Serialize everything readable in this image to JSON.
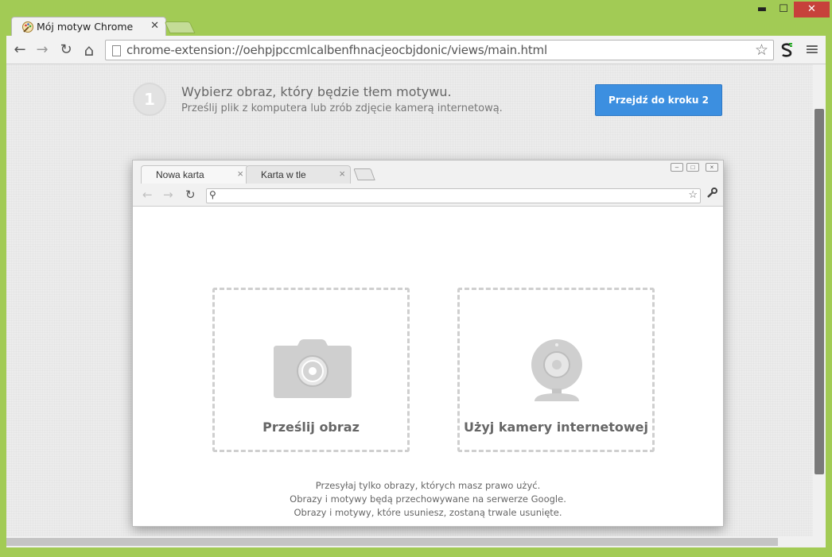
{
  "window": {
    "tab_title": "Mój motyw Chrome",
    "minimize": "▬",
    "maximize": "☐",
    "close": "✕"
  },
  "toolbar": {
    "back": "←",
    "forward": "→",
    "reload": "↻",
    "home": "⌂",
    "url": "chrome-extension://oehpjpccmlcalbenfhnacjeocbjdonic/views/main.html",
    "star": "☆",
    "menu": "≡"
  },
  "step": {
    "number": "1",
    "title": "Wybierz obraz, który będzie tłem motywu.",
    "subtitle": "Prześlij plik z komputera lub zrób zdjęcie kamerą internetową.",
    "next_button": "Przejdź do kroku 2"
  },
  "mock_browser": {
    "tabs": [
      {
        "label": "Nowa karta"
      },
      {
        "label": "Karta w tle"
      }
    ],
    "tab_close": "×",
    "upload_label": "Prześlij obraz",
    "camera_label": "Użyj kamery internetowej",
    "footnotes": [
      "Przesyłaj tylko obrazy, których masz prawo użyć.",
      "Obrazy i motywy będą przechowywane na serwerze Google.",
      "Obrazy i motywy, które usuniesz, zostaną trwale usunięte."
    ]
  },
  "colors": {
    "frame": "#a2cb55",
    "accent_button": "#3c8fe0",
    "close_button": "#c7413b"
  },
  "icons": {
    "tab_favicon": "palette-icon",
    "extension": "extension-s-icon",
    "upload": "camera-icon",
    "webcam": "webcam-icon",
    "wrench": "wrench-icon"
  }
}
